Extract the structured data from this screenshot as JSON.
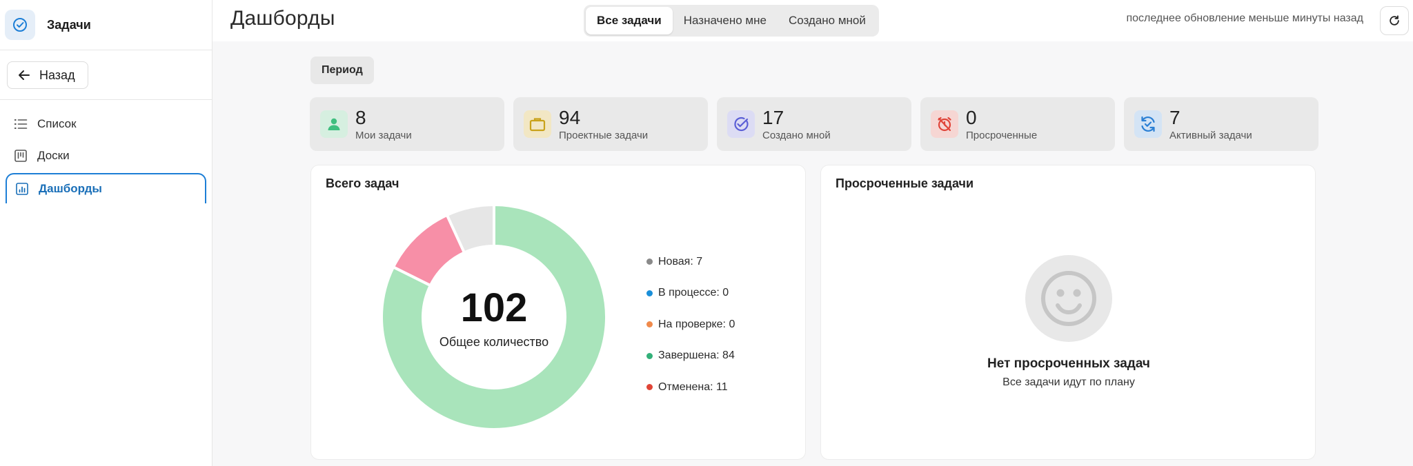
{
  "app": {
    "title": "Задачи"
  },
  "sidebar": {
    "back_label": "Назад",
    "items": [
      {
        "label": "Список",
        "icon": "list-icon"
      },
      {
        "label": "Доски",
        "icon": "board-icon"
      },
      {
        "label": "Дашборды",
        "icon": "dashboard-icon",
        "active": true
      }
    ]
  },
  "header": {
    "title": "Дашборды",
    "tabs": [
      {
        "label": "Все задачи",
        "active": true
      },
      {
        "label": "Назначено мне"
      },
      {
        "label": "Создано мной"
      }
    ],
    "updated": "последнее обновление меньше минуты назад"
  },
  "period_label": "Период",
  "stats": [
    {
      "value": "8",
      "label": "Мои задачи",
      "icon": "user-icon",
      "color": "#3fbf7f",
      "bg": "#d6efe0"
    },
    {
      "value": "94",
      "label": "Проектные задачи",
      "icon": "briefcase-icon",
      "color": "#c9a21a",
      "bg": "#f2e7c4"
    },
    {
      "value": "17",
      "label": "Создано мной",
      "icon": "check-circle-icon",
      "color": "#5b5fd6",
      "bg": "#dcdcf4"
    },
    {
      "value": "0",
      "label": "Просроченные",
      "icon": "alarm-off-icon",
      "color": "#e0453a",
      "bg": "#f6d6d3"
    },
    {
      "value": "7",
      "label": "Активный задачи",
      "icon": "refresh-check-icon",
      "color": "#2a7fd4",
      "bg": "#d4e4f5"
    }
  ],
  "total_panel": {
    "title": "Всего задач",
    "total": "102",
    "total_label": "Общее количество"
  },
  "chart_data": {
    "type": "pie",
    "title": "Всего задач",
    "categories": [
      "Новая",
      "В процессе",
      "На проверке",
      "Завершена",
      "Отменена"
    ],
    "values": [
      7,
      0,
      0,
      84,
      11
    ],
    "legend_labels": [
      "Новая: 7",
      "В процессе: 0",
      "На проверке: 0",
      "Завершена: 84",
      "Отменена: 11"
    ],
    "legend_colors": [
      "#8a8a8a",
      "#1a8fd9",
      "#f08a4b",
      "#33b079",
      "#e04436"
    ],
    "slice_colors": [
      "#e6e6e6",
      "#8fc9ef",
      "#f7c6a6",
      "#a9e4bb",
      "#f78fa7"
    ],
    "legend_position": "right"
  },
  "overdue_panel": {
    "title": "Просроченные задачи",
    "empty_title": "Нет просроченных задач",
    "empty_subtitle": "Все задачи идут по плану"
  }
}
